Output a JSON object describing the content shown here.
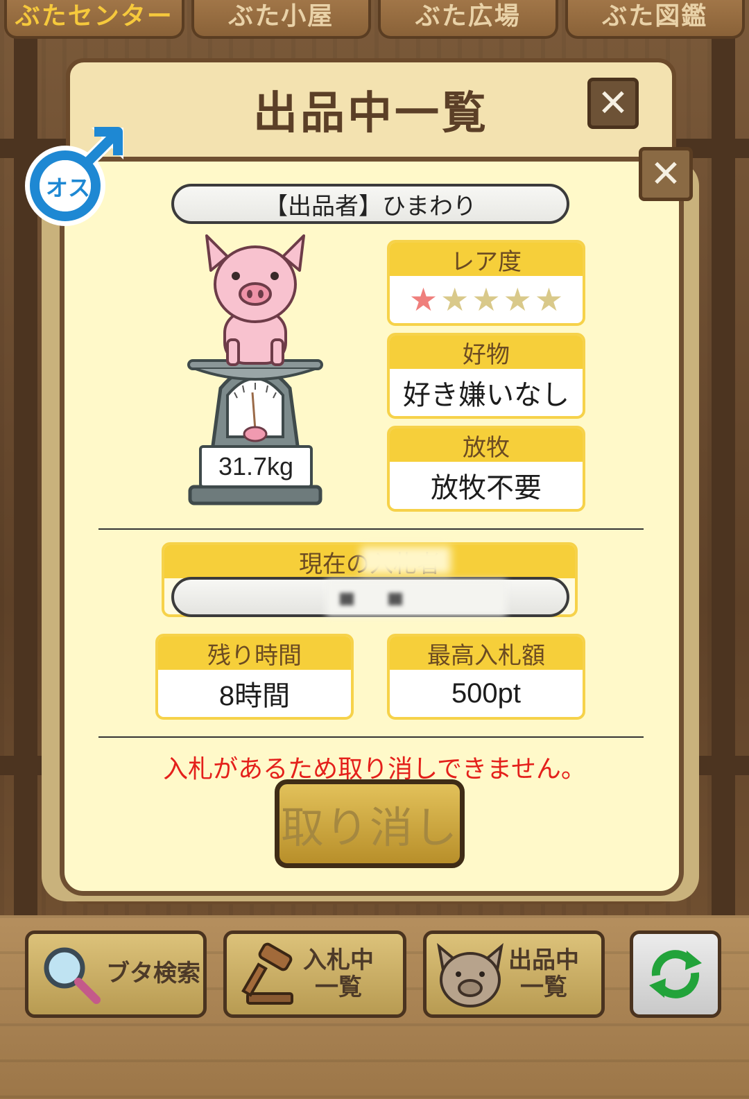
{
  "top_tabs": [
    {
      "label": "ぶたセンター",
      "active": true
    },
    {
      "label": "ぶた小屋",
      "active": false
    },
    {
      "label": "ぶた広場",
      "active": false
    },
    {
      "label": "ぶた図鑑",
      "active": false
    }
  ],
  "back_modal": {
    "title": "出品中一覧",
    "close_glyph": "✕"
  },
  "card": {
    "close_glyph": "✕",
    "gender_badge": "オス",
    "seller": "【出品者】ひまわり",
    "weight": "31.7kg",
    "rarity": {
      "label": "レア度",
      "stars_filled": 1,
      "stars_total": 5
    },
    "favorite": {
      "label": "好物",
      "value": "好き嫌いなし"
    },
    "grazing": {
      "label": "放牧",
      "value": "放牧不要"
    },
    "current_bidder": {
      "label": "現在の入札者"
    },
    "remaining_time": {
      "label": "残り時間",
      "value": "8時間"
    },
    "highest_bid": {
      "label": "最高入札額",
      "value": "500pt"
    },
    "notice": "入札があるため取り消しできません。",
    "cancel_label": "取り消し"
  },
  "bottom_nav": [
    {
      "label_line1": "ブタ検索",
      "label_line2": "",
      "icon": "magnifier-icon"
    },
    {
      "label_line1": "入札中",
      "label_line2": "一覧",
      "icon": "gavel-icon"
    },
    {
      "label_line1": "出品中",
      "label_line2": "一覧",
      "icon": "pig-face-icon"
    },
    {
      "label_line1": "",
      "label_line2": "",
      "icon": "refresh-icon"
    }
  ],
  "colors": {
    "accent_yellow": "#f6cf3a",
    "notice_red": "#e4201b",
    "male_blue": "#1e88d3",
    "star_filled": "#ef7f7c",
    "star_empty": "#d9c98a"
  }
}
